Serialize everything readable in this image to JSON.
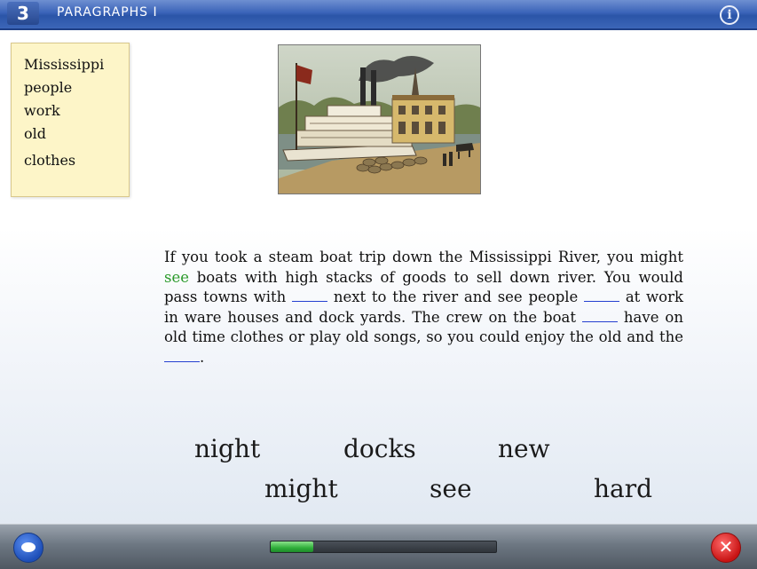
{
  "header": {
    "lesson_number": "3",
    "title": "PARAGRAPHS I",
    "info_glyph": "i"
  },
  "word_list": [
    "Mississippi",
    "people",
    "work",
    "old",
    "clothes"
  ],
  "paragraph": {
    "s1": "If you took a steam boat trip down the Mississippi River, you might ",
    "filled1": "see",
    "s2": " boats with high stacks of goods to sell down river.  You would pass towns with ",
    "s3": " next to the river and see people ",
    "s4": " at work in ware houses and dock yards.  The crew on the boat ",
    "s5": " have on old time clothes or play old songs, so you could enjoy the old and the ",
    "s6": "."
  },
  "choices": [
    "night",
    "docks",
    "new",
    "might",
    "see",
    "hard"
  ],
  "progress": {
    "fraction": 0.19
  },
  "bottom": {
    "close_glyph": "✕"
  },
  "colors": {
    "header_blue": "#2b55a8",
    "filled_word": "#2a9a2a",
    "blank_line": "#2540d0",
    "word_box": "#fdf5c8"
  }
}
